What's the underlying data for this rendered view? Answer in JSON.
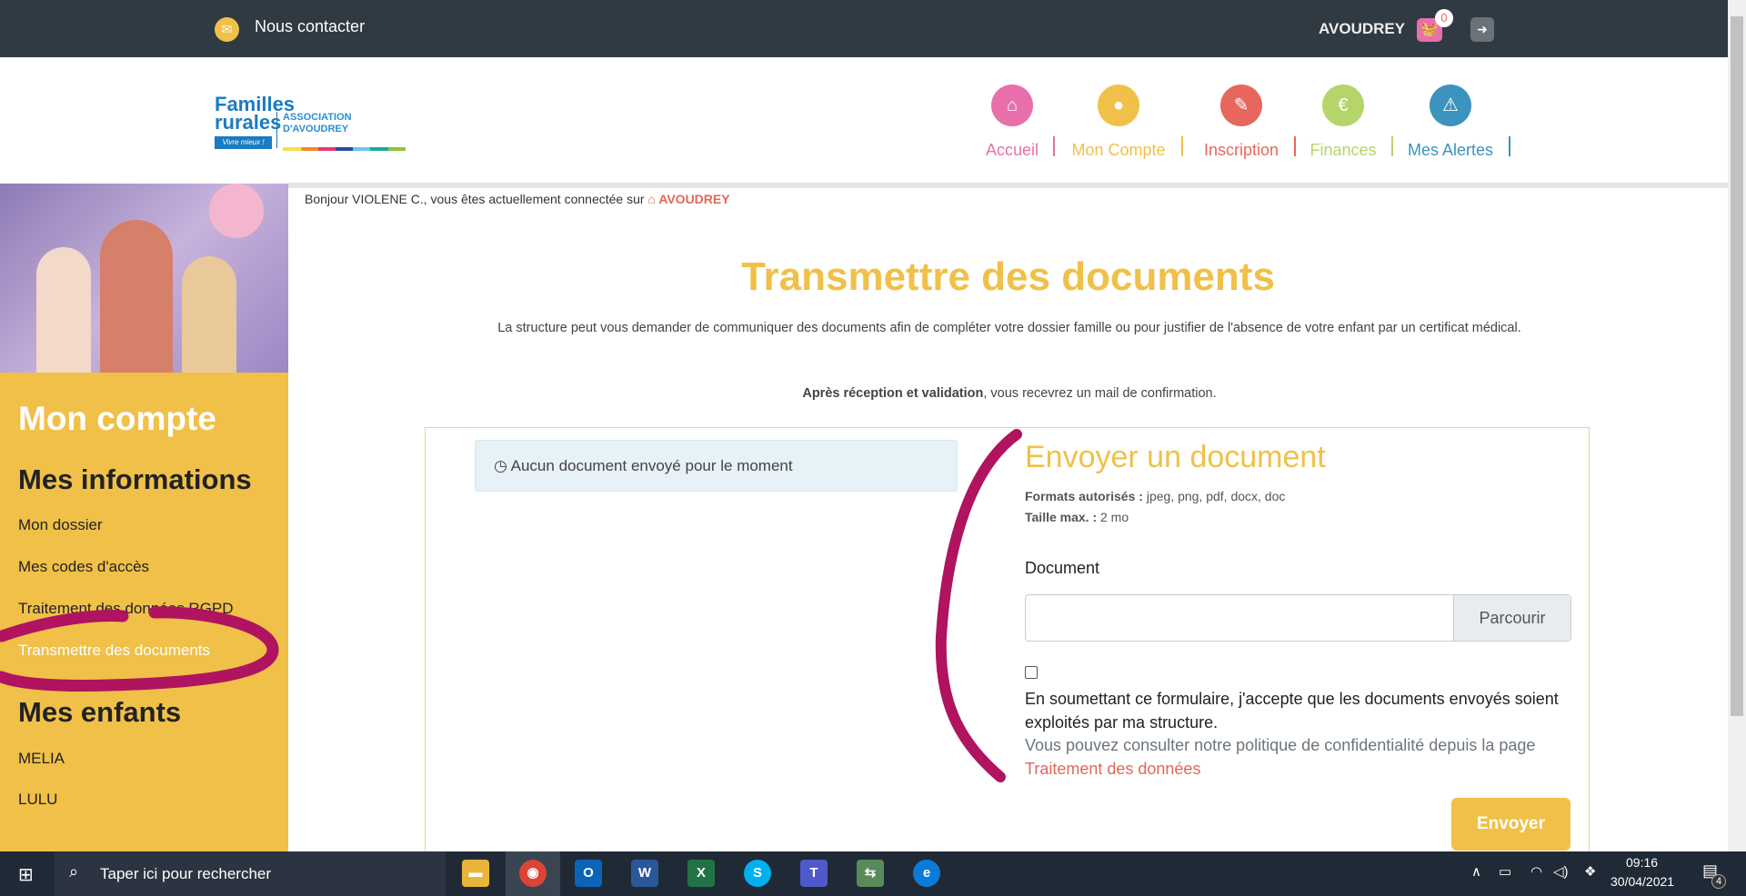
{
  "topbar": {
    "contact": "Nous contacter",
    "user": "AVOUDREY",
    "cart_count": "0"
  },
  "logo": {
    "brand_line1": "Familles",
    "brand_line2": "rurales",
    "tagline": "Vivre mieux !",
    "assoc_line1": "ASSOCIATION",
    "assoc_line2": "D'AVOUDREY"
  },
  "nav": [
    {
      "label": "Accueil",
      "color": "#e86fa9"
    },
    {
      "label": "Mon Compte",
      "color": "#f0c048"
    },
    {
      "label": "Inscription",
      "color": "#e8675d"
    },
    {
      "label": "Finances",
      "color": "#b5d56a"
    },
    {
      "label": "Mes Alertes",
      "color": "#3c93bd"
    }
  ],
  "greeting": {
    "text": "Bonjour VIOLENE C., vous êtes actuellement connectée sur",
    "site": "AVOUDREY"
  },
  "sidebar": {
    "title": "Mon compte",
    "section1": "Mes informations",
    "items": [
      "Mon dossier",
      "Mes codes d'accès",
      "Traitement des données RGPD",
      "Transmettre des documents"
    ],
    "section2": "Mes enfants",
    "children": [
      "MELIA",
      "LULU"
    ]
  },
  "main": {
    "title": "Transmettre des documents",
    "intro": "La structure peut vous demander de communiquer des documents afin de compléter votre dossier famille ou pour justifier de l'absence de votre enfant par un certificat médical.",
    "confirm_bold": "Après réception et validation",
    "confirm_rest": ", vous recevrez un mail de confirmation.",
    "no_docs": "Aucun document envoyé pour le moment"
  },
  "form": {
    "heading": "Envoyer un document",
    "formats_label": "Formats autorisés :",
    "formats": "jpeg, png, pdf, docx, doc",
    "size_label": "Taille max. :",
    "size": "2 mo",
    "doc_label": "Document",
    "browse": "Parcourir",
    "consent": "En soumettant ce formulaire, j'accepte que les documents envoyés soient exploités par ma structure.",
    "privacy": "Vous pouvez consulter notre politique de confidentialité depuis la page",
    "privacy_link": "Traitement des données",
    "submit": "Envoyer"
  },
  "taskbar": {
    "search": "Taper ici pour rechercher",
    "time": "09:16",
    "date": "30/04/2021",
    "notifications": "4"
  },
  "colors": {
    "accent": "#f0c048",
    "annotation": "#b0135f",
    "dark": "#2f3a42"
  }
}
